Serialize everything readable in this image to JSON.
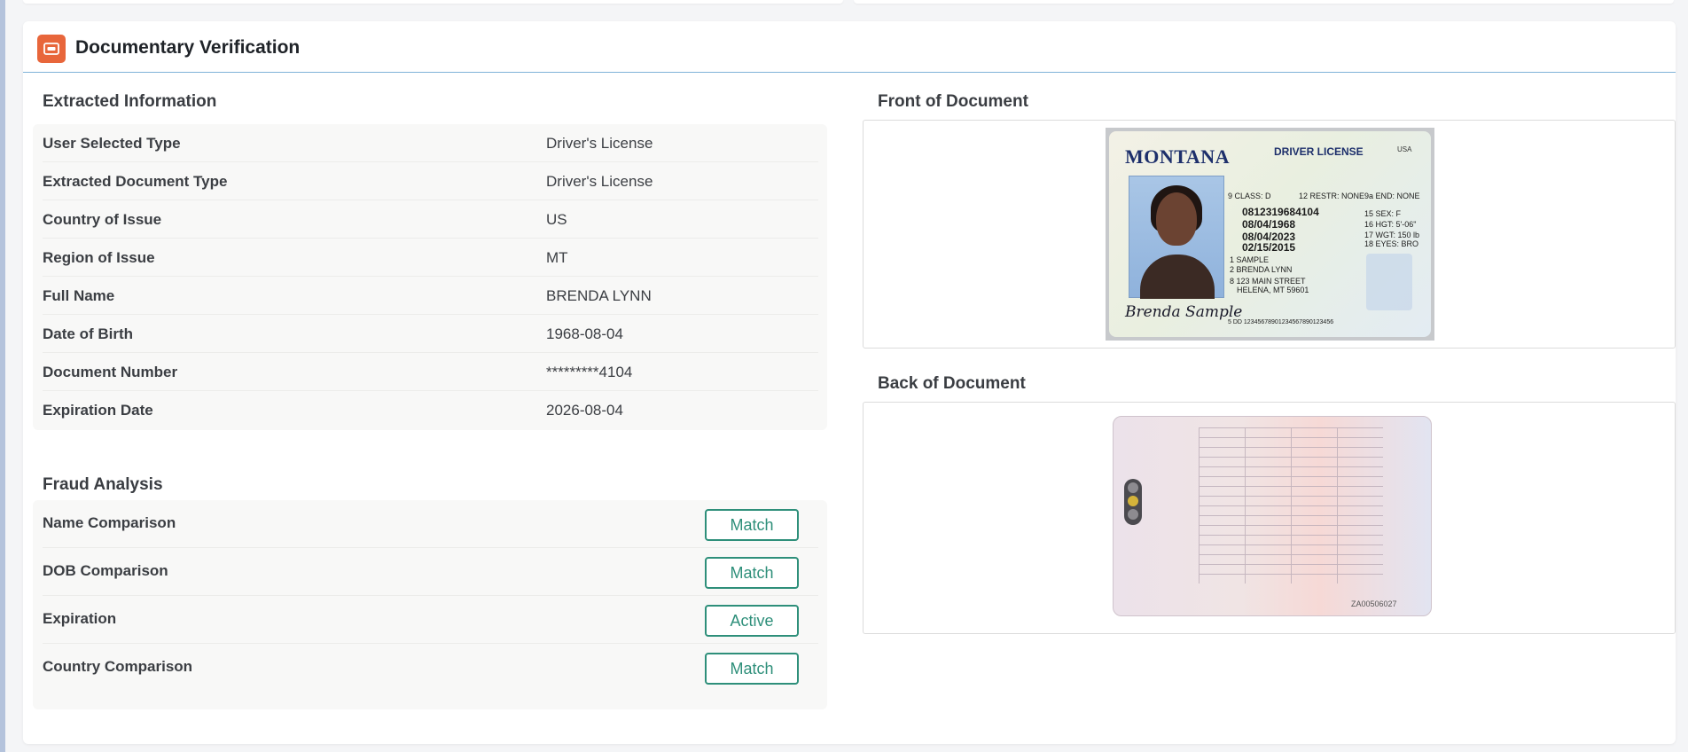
{
  "card": {
    "title": "Documentary Verification"
  },
  "extracted": {
    "title": "Extracted Information",
    "rows": [
      {
        "label": "User Selected Type",
        "value": "Driver's License"
      },
      {
        "label": "Extracted Document Type",
        "value": "Driver's License"
      },
      {
        "label": "Country of Issue",
        "value": "US"
      },
      {
        "label": "Region of Issue",
        "value": "MT"
      },
      {
        "label": "Full Name",
        "value": "BRENDA LYNN"
      },
      {
        "label": "Date of Birth",
        "value": "1968-08-04"
      },
      {
        "label": "Document Number",
        "value": "*********4104"
      },
      {
        "label": "Expiration Date",
        "value": "2026-08-04"
      }
    ]
  },
  "fraud": {
    "title": "Fraud Analysis",
    "rows": [
      {
        "label": "Name Comparison",
        "status": "Match"
      },
      {
        "label": "DOB Comparison",
        "status": "Match"
      },
      {
        "label": "Expiration",
        "status": "Active"
      },
      {
        "label": "Country Comparison",
        "status": "Match"
      }
    ]
  },
  "front": {
    "title": "Front of Document",
    "state": "MONTANA",
    "doc_type": "DRIVER LICENSE",
    "country": "USA",
    "fields": {
      "class": "9 CLASS: D",
      "restr": "12 RESTR: NONE",
      "end": "9a END: NONE",
      "lic": "0812319684104",
      "dob": "08/04/1968",
      "exp": "08/04/2023",
      "iss": "02/15/2015",
      "sex": "15 SEX: F",
      "hgt": "16 HGT: 5'-06\"",
      "wgt": "17 WGT: 150 lb",
      "eyes": "18 EYES: BRO",
      "name1": "1 SAMPLE",
      "name2": "2 BRENDA LYNN",
      "addr1": "8 123 MAIN STREET",
      "addr2": "HELENA, MT 59601",
      "dd": "5 DD 12345678901234567890123456",
      "signature": "Brenda Sample"
    }
  },
  "back": {
    "title": "Back of Document",
    "serial": "ZA00506027"
  },
  "colors": {
    "accent_orange": "#e8663b",
    "badge_green": "#2e8f7a",
    "header_rule": "#7fb3d8"
  }
}
